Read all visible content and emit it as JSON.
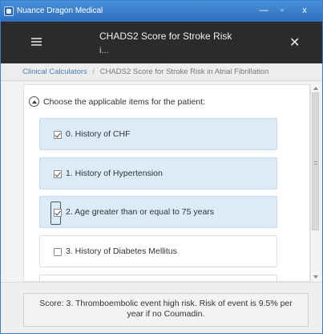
{
  "window": {
    "title": "Nuance Dragon Medical",
    "minimize_glyph": "—",
    "maximize_glyph": "▫",
    "close_glyph": "x"
  },
  "header": {
    "title": "CHADS2 Score for Stroke Risk",
    "subtitle": "i...",
    "menu_icon": "hamburger-icon",
    "close_glyph": "✕"
  },
  "breadcrumb": {
    "link": "Clinical Calculators",
    "separator": "/",
    "current": "CHADS2 Score for Stroke Risk in Atrial Fibrillation"
  },
  "section": {
    "label": "Choose the applicable items for the patient:"
  },
  "items": [
    {
      "label": "0. History of CHF",
      "checked": true
    },
    {
      "label": "1. History of Hypertension",
      "checked": true
    },
    {
      "label": "2. Age greater than or equal to 75 years",
      "checked": true
    },
    {
      "label": "3. History of Diabetes Mellitus",
      "checked": false
    },
    {
      "label": "",
      "checked": false
    }
  ],
  "score": {
    "text": "Score: 3. Thromboembolic event high risk. Risk of event is 9.5% per year if no Coumadin."
  },
  "colors": {
    "titlebar": "#3a7dc9",
    "header": "#2b2b2b",
    "checked_item": "#dcebf7",
    "link": "#4a7fb8"
  }
}
